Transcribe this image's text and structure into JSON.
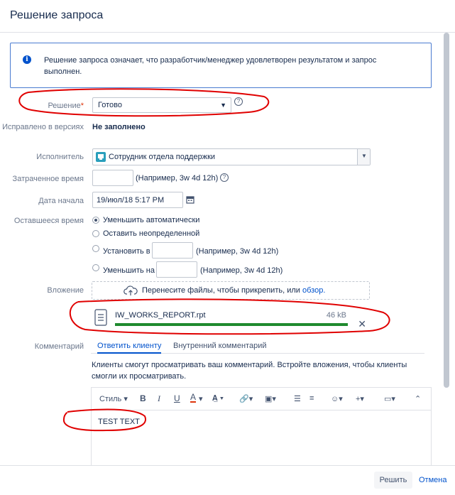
{
  "dialog": {
    "title": "Решение запроса",
    "info_text": "Решение запроса означает, что разработчик/менеджер удовлетворен результатом и запрос выполнен."
  },
  "fields": {
    "resolution": {
      "label": "Решение",
      "required_mark": "*",
      "value": "Готово"
    },
    "fix_versions": {
      "label": "Исправлено в версиях",
      "value": "Не заполнено"
    },
    "assignee": {
      "label": "Исполнитель",
      "value": "Сотрудник отдела поддержки"
    },
    "time_spent": {
      "label": "Затраченное время",
      "value": "",
      "hint": "(Например, 3w 4d 12h)"
    },
    "start_date": {
      "label": "Дата начала",
      "value": "19/июл/18 5:17 PM"
    },
    "remaining": {
      "label": "Оставшееся время",
      "options": [
        {
          "label": "Уменьшить автоматически",
          "selected": true
        },
        {
          "label": "Оставить неопределенной",
          "selected": false
        },
        {
          "label": "Установить в",
          "selected": false,
          "hint": "(Например, 3w 4d 12h)"
        },
        {
          "label": "Уменьшить на",
          "selected": false,
          "hint": "(Например, 3w 4d 12h)"
        }
      ]
    },
    "attachment": {
      "label": "Вложение",
      "drop_text": "Перенесите файлы, чтобы прикрепить, или ",
      "browse_link": "обзор.",
      "file": {
        "name": "IW_WORKS_REPORT.rpt",
        "size": "46 kB",
        "progress": 1.0
      }
    },
    "comment": {
      "label": "Комментарий",
      "tabs": [
        {
          "label": "Ответить клиенту",
          "active": true
        },
        {
          "label": "Внутренний комментарий",
          "active": false
        }
      ],
      "hint": "Клиенты смогут просматривать ваш комментарий. Встройте вложения, чтобы клиенты смогли их просматривать.",
      "toolbar": {
        "style_label": "Стиль"
      },
      "text": "TEST TEXT"
    }
  },
  "footer": {
    "resolve_label": "Решить",
    "cancel_label": "Отмена"
  },
  "colors": {
    "accent": "#0052cc",
    "progress": "#1f8a2e",
    "annotation": "#e00000"
  }
}
